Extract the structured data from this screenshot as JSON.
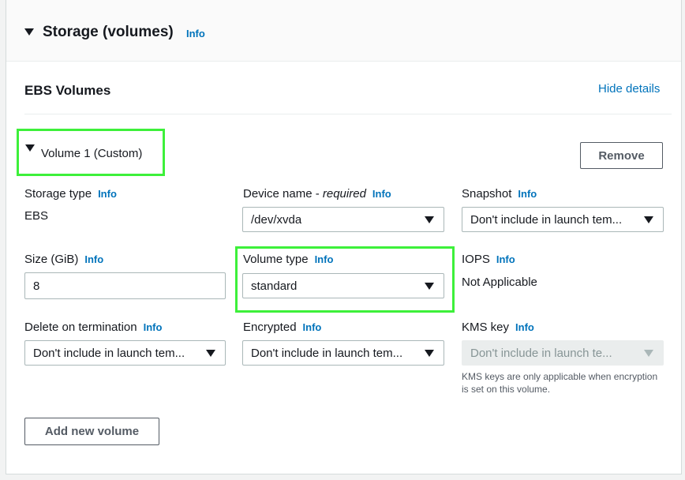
{
  "header": {
    "title": "Storage (volumes)",
    "info": "Info"
  },
  "ebs": {
    "title": "EBS Volumes",
    "hide_details": "Hide details"
  },
  "volume": {
    "title": "Volume 1 (Custom)",
    "remove_label": "Remove",
    "storage_type": {
      "label": "Storage type",
      "info": "Info",
      "value": "EBS"
    },
    "device_name": {
      "label": "Device name - ",
      "label_emph": "required",
      "info": "Info",
      "value": "/dev/xvda"
    },
    "snapshot": {
      "label": "Snapshot",
      "info": "Info",
      "value": "Don't include in launch tem..."
    },
    "size": {
      "label": "Size (GiB)",
      "info": "Info",
      "value": "8"
    },
    "volume_type": {
      "label": "Volume type",
      "info": "Info",
      "value": "standard"
    },
    "iops": {
      "label": "IOPS",
      "info": "Info",
      "value": "Not Applicable"
    },
    "delete_on_termination": {
      "label": "Delete on termination",
      "info": "Info",
      "value": "Don't include in launch tem..."
    },
    "encrypted": {
      "label": "Encrypted",
      "info": "Info",
      "value": "Don't include in launch tem..."
    },
    "kms_key": {
      "label": "KMS key",
      "info": "Info",
      "value": "Don't include in launch te...",
      "hint": "KMS keys are only applicable when encryption is set on this volume."
    }
  },
  "add_volume_label": "Add new volume",
  "icons": {
    "expand": "caret-down-icon",
    "dropdown": "chevron-down-icon"
  },
  "colors": {
    "link": "#0073bb",
    "highlight": "#3df03a"
  }
}
